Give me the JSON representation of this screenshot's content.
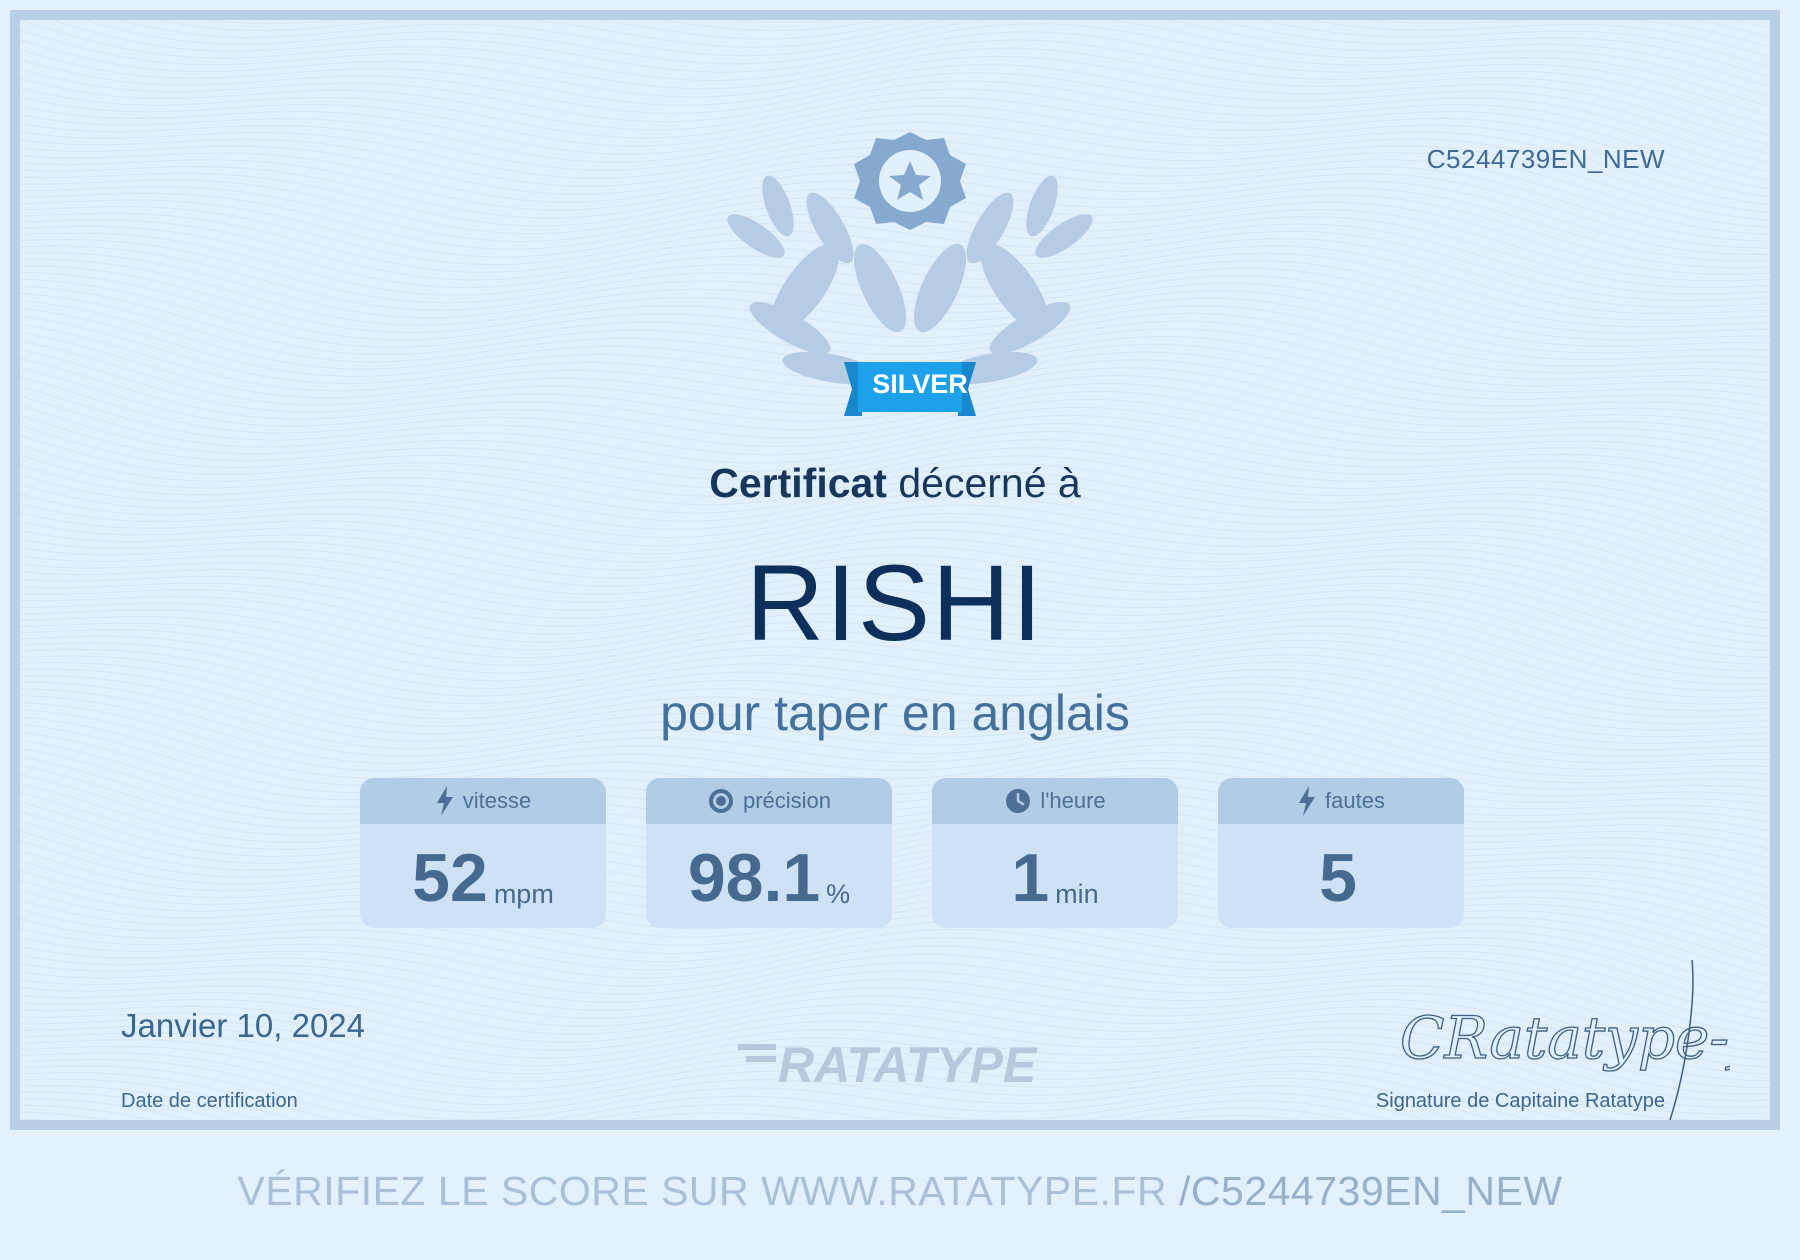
{
  "certificate": {
    "id": "C5244739EN_NEW",
    "level_badge": "SILVER",
    "heading_bold": "Certificat",
    "heading_rest": "décerné à",
    "recipient_name": "RISHI",
    "purpose": "pour taper en anglais"
  },
  "stats": [
    {
      "icon": "lightning-icon",
      "label": "vitesse",
      "value": "52",
      "unit": "mpm"
    },
    {
      "icon": "target-icon",
      "label": "précision",
      "value": "98.1",
      "unit": "%"
    },
    {
      "icon": "clock-icon",
      "label": "l'heure",
      "value": "1",
      "unit": "min"
    },
    {
      "icon": "lightning-icon",
      "label": "fautes",
      "value": "5",
      "unit": ""
    }
  ],
  "footer": {
    "date": "Janvier 10, 2024",
    "date_label": "Date de certification",
    "logo_text": "RATATYPE",
    "signature_text": "CRatatype-fé",
    "signature_label": "Signature de Capitaine Ratatype"
  },
  "verify": {
    "prefix": "VÉRIFIEZ LE SCORE SUR WWW.RATATYPE.FR",
    "code": "/C5244739EN_NEW"
  },
  "colors": {
    "accent_ribbon": "#1da1ea",
    "badge_blue": "#86a9cf",
    "laurel": "#b6cbe4",
    "name_navy": "#0d2f5c",
    "frame": "#b9cfe6"
  }
}
